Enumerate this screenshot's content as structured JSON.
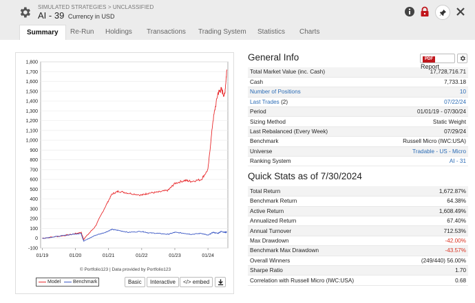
{
  "header": {
    "breadcrumb": "SIMULATED STRATEGIES > UNCLASSIFIED",
    "title": "AI - 39",
    "currency": "Currency in USD"
  },
  "tabs": [
    "Summary",
    "Re-Run",
    "Holdings",
    "Transactions",
    "Trading System",
    "Statistics",
    "Charts"
  ],
  "chart_data": {
    "type": "line",
    "x_tick_labels": [
      "01/19",
      "01/20",
      "01/21",
      "01/22",
      "01/23",
      "01/24"
    ],
    "y_tick_labels": [
      "1,800",
      "1,700",
      "1,600",
      "1,500",
      "1,400",
      "1,300",
      "1,200",
      "1,100",
      "1,000",
      "900",
      "800",
      "700",
      "600",
      "500",
      "400",
      "300",
      "200",
      "100",
      "0",
      "-100"
    ],
    "ylim": [
      -100,
      1800
    ],
    "x": [
      2019.0,
      2019.5,
      2019.9,
      2020.17,
      2020.25,
      2020.6,
      2020.9,
      2021.1,
      2021.3,
      2021.6,
      2022.0,
      2022.2,
      2022.5,
      2022.8,
      2023.0,
      2023.3,
      2023.5,
      2023.8,
      2024.0,
      2024.15,
      2024.3,
      2024.4,
      2024.5,
      2024.57
    ],
    "series": [
      {
        "name": "Model",
        "color": "#e8282b",
        "values": [
          0,
          20,
          40,
          60,
          -10,
          120,
          320,
          450,
          480,
          460,
          440,
          460,
          470,
          490,
          560,
          590,
          580,
          600,
          700,
          1200,
          1480,
          1520,
          1450,
          1720
        ]
      },
      {
        "name": "Benchmark",
        "color": "#3a57c4",
        "values": [
          0,
          20,
          40,
          50,
          -30,
          30,
          60,
          90,
          80,
          60,
          70,
          55,
          50,
          40,
          60,
          50,
          40,
          50,
          30,
          60,
          50,
          70,
          60,
          64
        ]
      }
    ],
    "legend": "bottom-left",
    "grid": true
  },
  "chart_credit": "© Portfolio123 | Data provided by Portfolio123",
  "chart_buttons": {
    "basic": "Basic",
    "interactive": "Interactive",
    "embed": "</> embed"
  },
  "general_info": {
    "title": "General Info",
    "pdf_badge": "PDF",
    "report_label": "Report",
    "rows": [
      {
        "label": "Total Market Value (inc. Cash)",
        "value": "17,728,716.71"
      },
      {
        "label": "Cash",
        "value": "7,733.18"
      },
      {
        "label": "Number of Positions",
        "value": "10",
        "link": true
      },
      {
        "label": "Last Trades",
        "suffix": "(2)",
        "value": "07/22/24",
        "link": true
      },
      {
        "label": "Period",
        "value": "01/01/19 - 07/30/24"
      },
      {
        "label": "Sizing Method",
        "value": "Static Weight"
      },
      {
        "label": "Last Rebalanced (Every Week)",
        "value": "07/29/24"
      },
      {
        "label": "Benchmark",
        "value": "Russell Micro (IWC:USA)"
      },
      {
        "label": "Universe",
        "value": "Tradable - US - Micro",
        "vlink": true
      },
      {
        "label": "Ranking System",
        "value": "AI - 31",
        "vlink": true
      }
    ]
  },
  "quick_stats": {
    "title": "Quick Stats as of 7/30/2024",
    "rows": [
      {
        "label": "Total Return",
        "value": "1,672.87%"
      },
      {
        "label": "Benchmark Return",
        "value": "64.38%"
      },
      {
        "label": "Active Return",
        "value": "1,608.49%"
      },
      {
        "label": "Annualized Return",
        "value": "67.40%"
      },
      {
        "label": "Annual Turnover",
        "value": "712.53%"
      },
      {
        "label": "Max Drawdown",
        "value": "-42.00%",
        "neg": true
      },
      {
        "label": "Benchmark Max Drawdown",
        "value": "-43.57%",
        "neg": true
      },
      {
        "label": "Overall Winners",
        "value": "(249/440) 56.00%"
      },
      {
        "label": "Sharpe Ratio",
        "value": "1.70"
      },
      {
        "label": "Correlation with Russell Micro (IWC:USA)",
        "value": "0.68"
      }
    ]
  },
  "colors": {
    "accent": "#2a6bb5",
    "negative": "#d9301f",
    "model": "#e8282b",
    "benchmark": "#3a57c4",
    "pdf": "#c0151b",
    "lock": "#c0151b"
  }
}
